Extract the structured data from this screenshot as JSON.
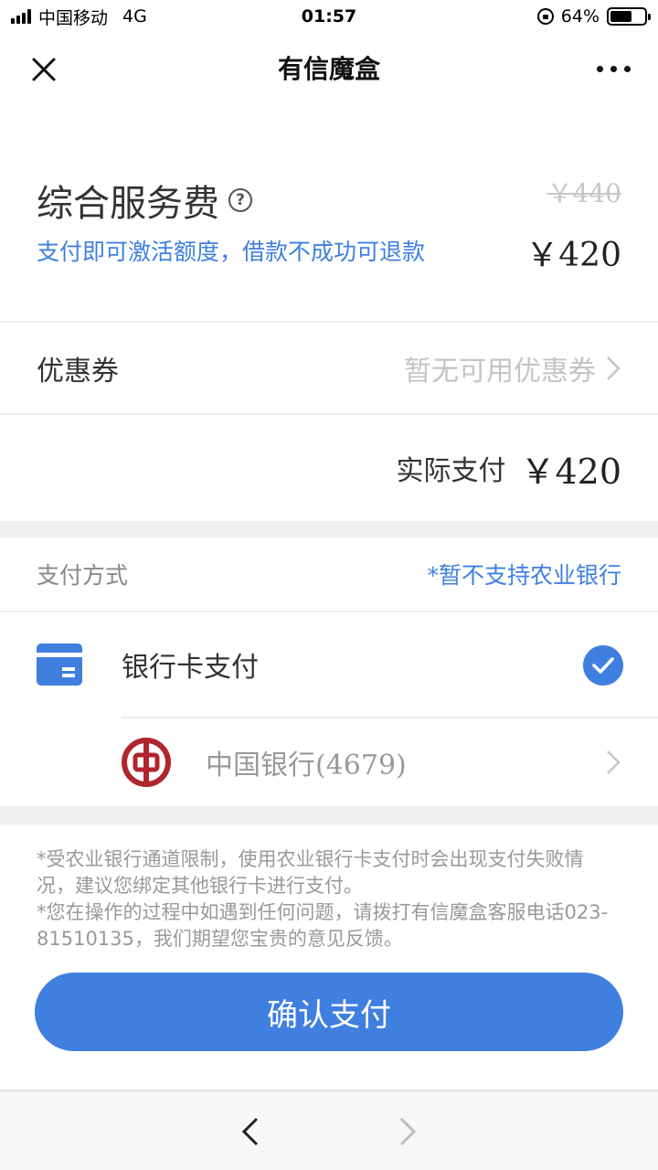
{
  "status_bar": {
    "carrier": "中国移动",
    "network": "4G",
    "time": "01:57",
    "battery": "64%",
    "battery_level": 0.64
  },
  "nav": {
    "title": "有信魔盒",
    "close_icon": "close-icon",
    "more_icon": "more-icon"
  },
  "fee": {
    "title": "综合服务费",
    "help_symbol": "?",
    "original_price": "￥440",
    "description": "支付即可激活额度，借款不成功可退款",
    "price": "￥420"
  },
  "coupon": {
    "label": "优惠券",
    "value": "暂无可用优惠券"
  },
  "actual": {
    "label": "实际支付",
    "price": "￥420"
  },
  "payment": {
    "title": "支付方式",
    "note": "*暂不支持农业银行",
    "method_label": "银行卡支付",
    "selected": true,
    "bank_name": "中国银行",
    "card_suffix": "(4679)"
  },
  "notes": [
    "*受农业银行通道限制，使用农业银行卡支付时会出现支付失败情况，建议您绑定其他银行卡进行支付。",
    "*您在操作的过程中如遇到任何问题，请拨打有信魔盒客服电话023-81510135，我们期望您宝贵的意见反馈。"
  ],
  "confirm_label": "确认支付",
  "colors": {
    "accent": "#3f7fe0",
    "boc_red": "#b0252e",
    "disabled_gray": "#c4c4c4"
  }
}
